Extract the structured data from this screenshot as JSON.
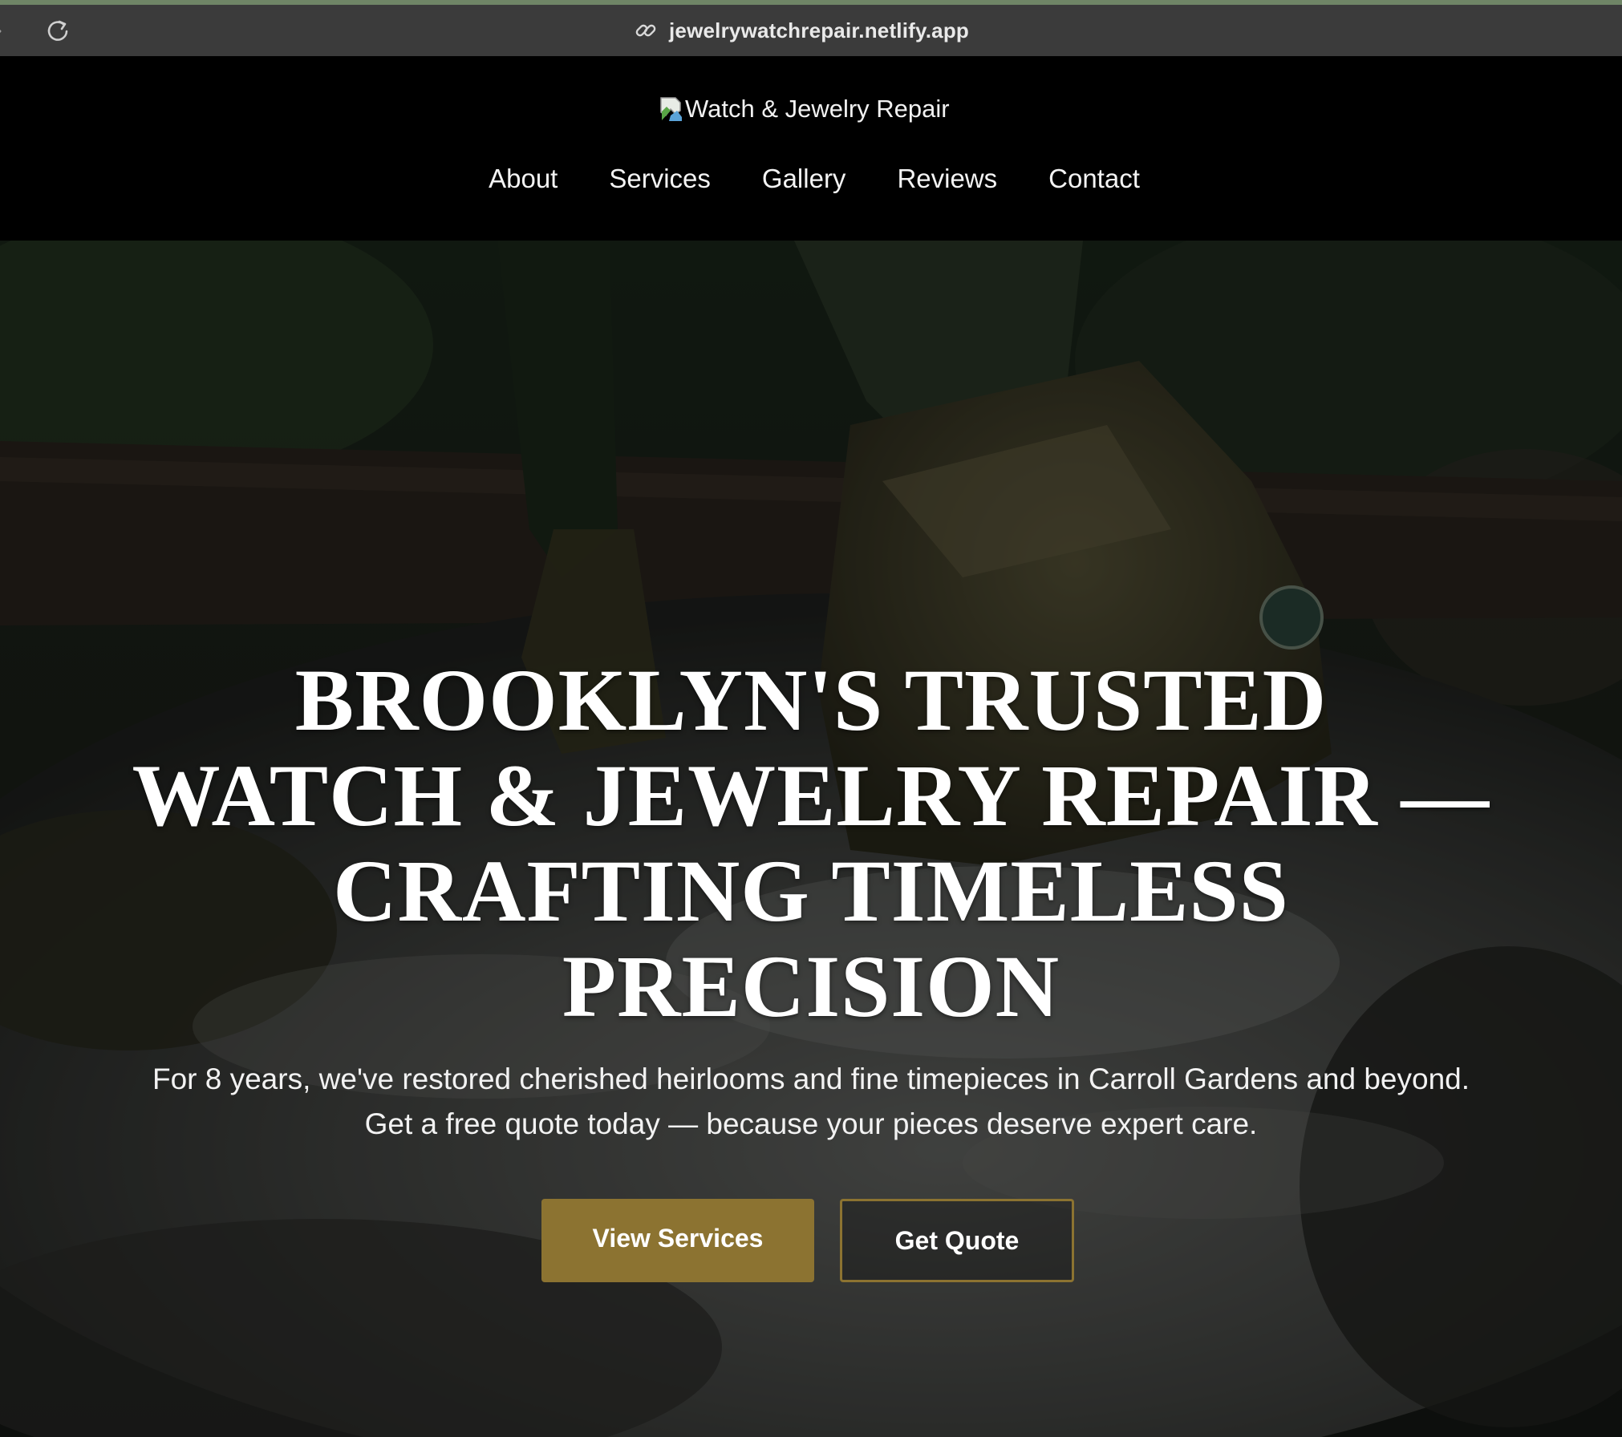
{
  "browser": {
    "url": "jewelrywatchrepair.netlify.app",
    "back_icon": "arrow-right-icon",
    "reload_icon": "reload-icon",
    "link_icon": "link-icon"
  },
  "header": {
    "logo_alt": "Watch & Jewelry Repair",
    "nav": [
      {
        "label": "About"
      },
      {
        "label": "Services"
      },
      {
        "label": "Gallery"
      },
      {
        "label": "Reviews"
      },
      {
        "label": "Contact"
      }
    ]
  },
  "hero": {
    "title_lines": [
      "BROOKLYN'S TRUSTED",
      "WATCH & JEWELRY REPAIR —",
      "CRAFTING TIMELESS",
      "PRECISION"
    ],
    "subtitle_lines": [
      "For 8 years, we've restored cherished heirlooms and fine timepieces in Carroll Gardens and beyond.",
      "Get a free quote today — because your pieces deserve expert care."
    ],
    "primary_button": "View Services",
    "secondary_button": "Get Quote"
  },
  "colors": {
    "accent_gold": "#8c7331",
    "header_bg": "#000000",
    "chrome_bg": "#3b3b3b"
  }
}
